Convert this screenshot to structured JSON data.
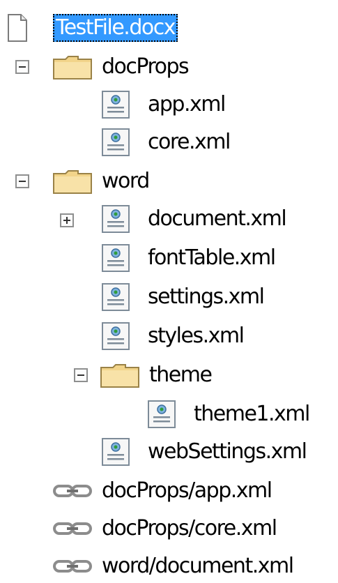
{
  "tree": {
    "items": [
      {
        "label": "TestFile.docx",
        "icon": "document-file-icon",
        "selected": true
      },
      {
        "label": "docProps",
        "icon": "folder-icon",
        "expander": "expanded"
      },
      {
        "label": "app.xml",
        "icon": "xml-file-icon"
      },
      {
        "label": "core.xml",
        "icon": "xml-file-icon"
      },
      {
        "label": "word",
        "icon": "folder-icon",
        "expander": "expanded"
      },
      {
        "label": "document.xml",
        "icon": "xml-file-icon",
        "expander": "collapsed"
      },
      {
        "label": "fontTable.xml",
        "icon": "xml-file-icon"
      },
      {
        "label": "settings.xml",
        "icon": "xml-file-icon"
      },
      {
        "label": "styles.xml",
        "icon": "xml-file-icon"
      },
      {
        "label": "theme",
        "icon": "folder-icon",
        "expander": "expanded"
      },
      {
        "label": "theme1.xml",
        "icon": "xml-file-icon"
      },
      {
        "label": "webSettings.xml",
        "icon": "xml-file-icon"
      },
      {
        "label": "docProps/app.xml",
        "icon": "relationship-link-icon"
      },
      {
        "label": "docProps/core.xml",
        "icon": "relationship-link-icon"
      },
      {
        "label": "word/document.xml",
        "icon": "relationship-link-icon"
      }
    ]
  }
}
